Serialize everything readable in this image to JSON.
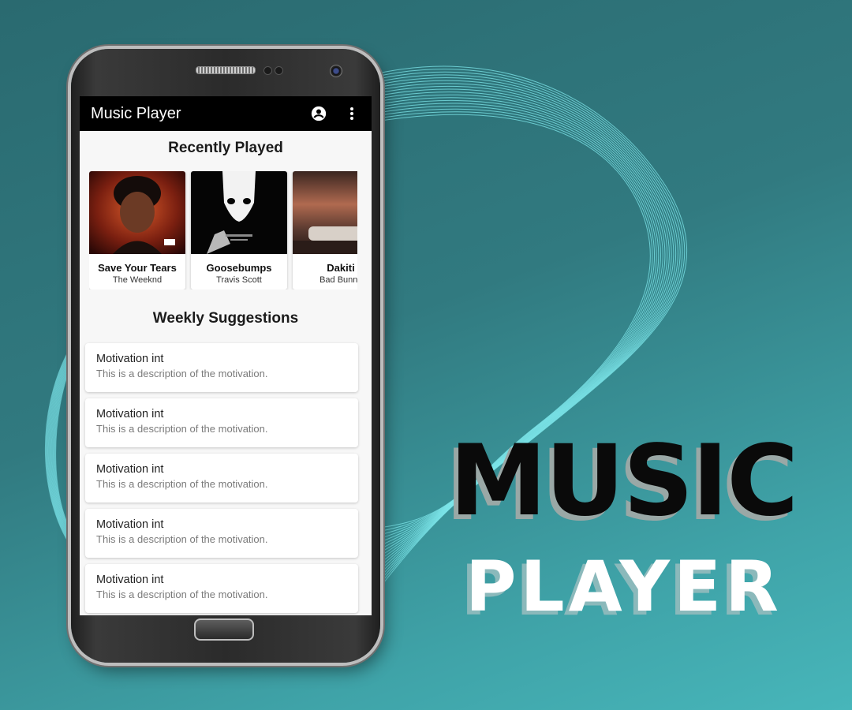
{
  "colors": {
    "background_start": "#2a6a70",
    "background_end": "#47b6ba",
    "wave_line": "#7fe8ec",
    "appbar": "#000000",
    "screen_bg": "#f7f7f7",
    "music_text": "#0a0a0a",
    "player_text": "#ffffff"
  },
  "app": {
    "title": "Music Player",
    "icons": {
      "account": "account-circle-icon",
      "menu": "more-vert-icon"
    }
  },
  "recently_played": {
    "title": "Recently Played",
    "items": [
      {
        "title": "Save Your Tears",
        "artist": "The Weeknd"
      },
      {
        "title": "Goosebumps",
        "artist": "Travis Scott"
      },
      {
        "title": "Dakiti",
        "artist": "Bad Bunny"
      }
    ]
  },
  "weekly_suggestions": {
    "title": "Weekly Suggestions",
    "items": [
      {
        "title": "Motivation int",
        "description": "This is a description of the motivation."
      },
      {
        "title": "Motivation int",
        "description": "This is a description of the motivation."
      },
      {
        "title": "Motivation int",
        "description": "This is a description of the motivation."
      },
      {
        "title": "Motivation int",
        "description": "This is a description of the motivation."
      },
      {
        "title": "Motivation int",
        "description": "This is a description of the motivation."
      }
    ]
  },
  "promo": {
    "line1": "MUSIC",
    "line2": "PLAYER"
  }
}
